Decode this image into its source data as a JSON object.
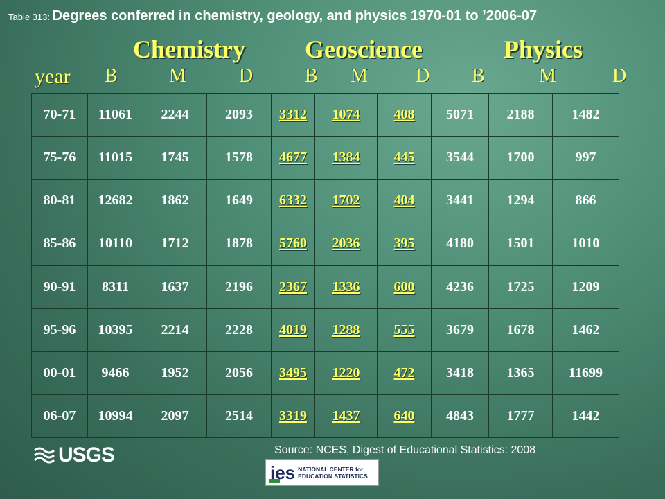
{
  "title": {
    "prefix": "Table 313: ",
    "main": "Degrees conferred in chemistry, geology, and physics 1970-01 to ’2006-07"
  },
  "groups": [
    "Chemistry",
    "Geoscience",
    "Physics"
  ],
  "subheads": {
    "year": "year",
    "degrees": [
      "B",
      "M",
      "D",
      "B",
      "M",
      "D",
      "B",
      "M",
      "D"
    ]
  },
  "rows": [
    [
      "70-71",
      "11061",
      "2244",
      "2093",
      "3312",
      "1074",
      "408",
      "5071",
      "2188",
      "1482"
    ],
    [
      "75-76",
      "11015",
      "1745",
      "1578",
      "4677",
      "1384",
      "445",
      "3544",
      "1700",
      "997"
    ],
    [
      "80-81",
      "12682",
      "1862",
      "1649",
      "6332",
      "1702",
      "404",
      "3441",
      "1294",
      "866"
    ],
    [
      "85-86",
      "10110",
      "1712",
      "1878",
      "5760",
      "2036",
      "395",
      "4180",
      "1501",
      "1010"
    ],
    [
      "90-91",
      "8311",
      "1637",
      "2196",
      "2367",
      "1336",
      "600",
      "4236",
      "1725",
      "1209"
    ],
    [
      "95-96",
      "10395",
      "2214",
      "2228",
      "4019",
      "1288",
      "555",
      "3679",
      "1678",
      "1462"
    ],
    [
      "00-01",
      "9466",
      "1952",
      "2056",
      "3495",
      "1220",
      "472",
      "3418",
      "1365",
      "11699"
    ],
    [
      "06-07",
      "10994",
      "2097",
      "2514",
      "3319",
      "1437",
      "640",
      "4843",
      "1777",
      "1442"
    ]
  ],
  "footer": {
    "usgs_wordmark": "USGS",
    "source": "Source: NCES, Digest of Educational Statistics: 2008",
    "ies_mark": "ies",
    "ies_text_line1": "NATIONAL CENTER for",
    "ies_text_line2": "EDUCATION STATISTICS"
  },
  "colors": {
    "heading_yellow": "#ffff66",
    "cell_text": "#ffffff",
    "background": "#4f8e77"
  }
}
